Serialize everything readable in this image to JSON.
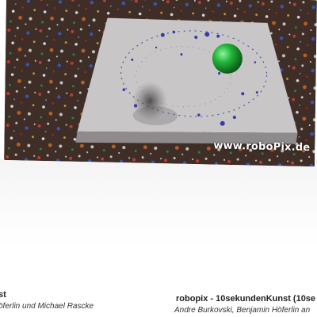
{
  "video": {
    "watermark": "www.roboPix.de",
    "colors": {
      "canvas": "#c9c6c7",
      "ball": "#22b33a",
      "paint": "#3b3aa5",
      "floor_dark": "#3a2a24"
    },
    "icon": "video-thumbnail"
  },
  "captions": {
    "left": {
      "title": "st",
      "subtitle": "öferlin und Michael Rascke"
    },
    "right": {
      "title": "robopix - 10sekundenKunst (10se",
      "subtitle": "Andre Burkovski, Benjamin Höferlin an"
    }
  }
}
